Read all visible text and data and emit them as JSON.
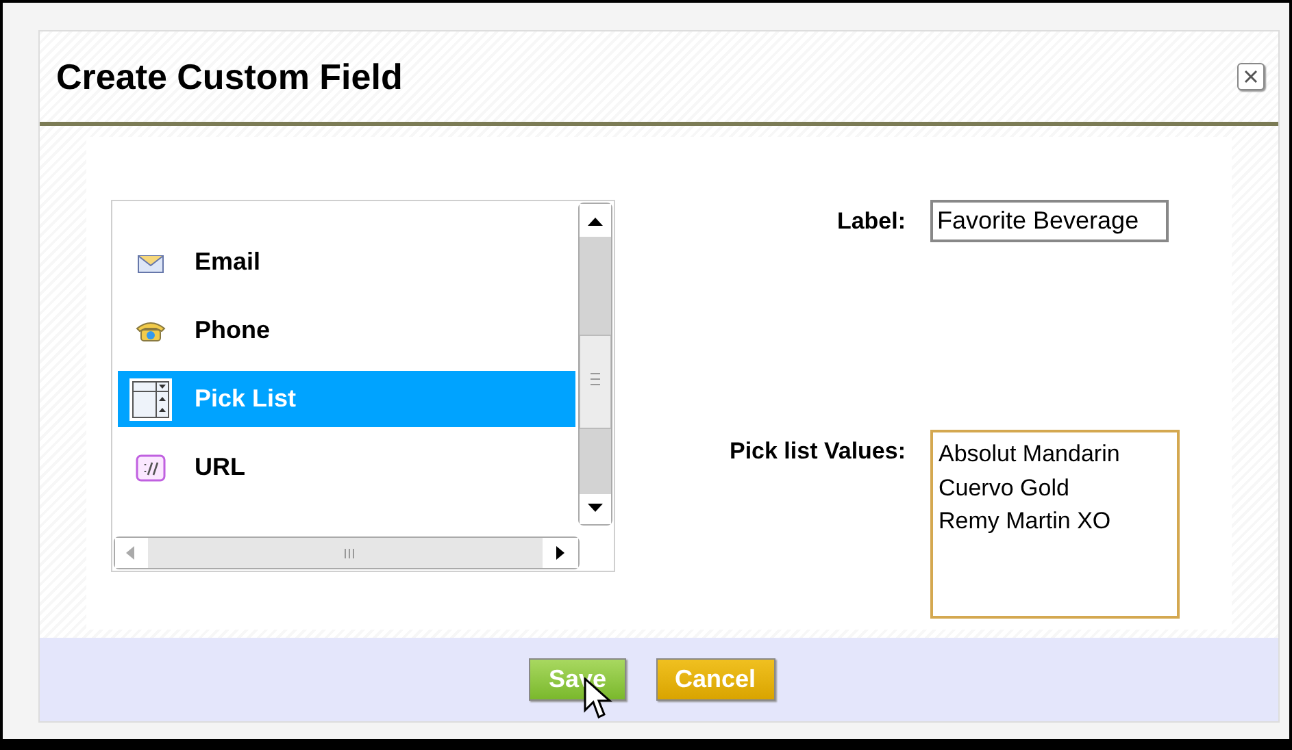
{
  "dialog": {
    "title": "Create Custom Field"
  },
  "field_types": [
    {
      "label": "Email",
      "kind": "email",
      "selected": false
    },
    {
      "label": "Phone",
      "kind": "phone",
      "selected": false
    },
    {
      "label": "Pick List",
      "kind": "picklist",
      "selected": true
    },
    {
      "label": "URL",
      "kind": "url",
      "selected": false
    }
  ],
  "form": {
    "label_caption": "Label:",
    "label_value": "Favorite Beverage",
    "values_caption": "Pick list Values:",
    "values_value": "Absolut Mandarin\nCuervo Gold\nRemy Martin XO"
  },
  "buttons": [
    {
      "label": "Save",
      "kind": "primary"
    },
    {
      "label": "Cancel",
      "kind": "secondary"
    }
  ]
}
